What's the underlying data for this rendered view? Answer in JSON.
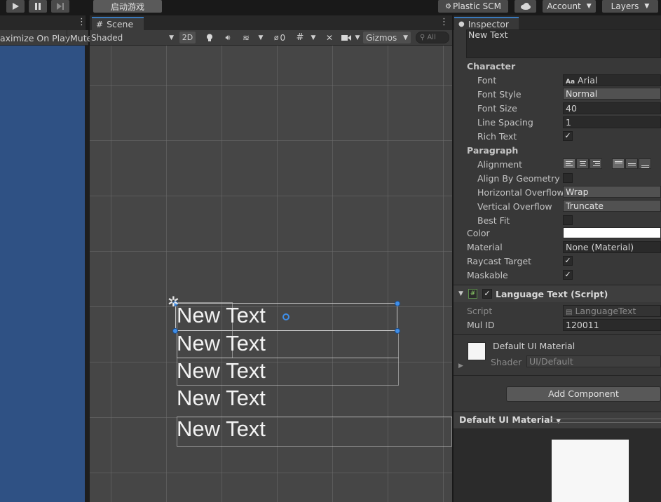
{
  "toolbar": {
    "play_icon": "play-icon",
    "pause_icon": "pause-icon",
    "step_icon": "step-icon",
    "start_game": "启动游戏",
    "plastic_scm": "Plastic SCM",
    "cloud_icon": "cloud-icon",
    "account": "Account",
    "layers": "Layers"
  },
  "game_view": {
    "maximize_on_play": "aximize On Play",
    "mute": "Mute",
    "background_color": "#2f5184"
  },
  "scene": {
    "tab_label": "Scene",
    "shading_mode": "Shaded",
    "mode_2d": "2D",
    "hidden_count": "0",
    "gizmos": "Gizmos",
    "search_placeholder": "All",
    "text_items": [
      "New Text",
      "New Text",
      "New Text",
      "New Text",
      "New Text"
    ]
  },
  "inspector": {
    "tab_label": "Inspector",
    "text_value": "New Text",
    "character_section": "Character",
    "font_label": "Font",
    "font_value": "Arial",
    "font_style_label": "Font Style",
    "font_style_value": "Normal",
    "font_size_label": "Font Size",
    "font_size_value": "40",
    "line_spacing_label": "Line Spacing",
    "line_spacing_value": "1",
    "rich_text_label": "Rich Text",
    "rich_text_checked": true,
    "paragraph_section": "Paragraph",
    "alignment_label": "Alignment",
    "align_by_geometry_label": "Align By Geometry",
    "align_by_geometry_checked": false,
    "horizontal_overflow_label": "Horizontal Overflow",
    "horizontal_overflow_value": "Wrap",
    "vertical_overflow_label": "Vertical Overflow",
    "vertical_overflow_value": "Truncate",
    "best_fit_label": "Best Fit",
    "best_fit_checked": false,
    "color_label": "Color",
    "color_value": "#ffffff",
    "material_label": "Material",
    "material_value": "None (Material)",
    "raycast_target_label": "Raycast Target",
    "raycast_target_checked": true,
    "maskable_label": "Maskable",
    "maskable_checked": true,
    "component_title": "Language Text (Script)",
    "script_label": "Script",
    "script_value": "LanguageText",
    "mul_id_label": "Mul ID",
    "mul_id_value": "120011",
    "material_name": "Default UI Material",
    "shader_label": "Shader",
    "shader_value": "UI/Default",
    "add_component": "Add Component",
    "preview_title": "Default UI Material"
  }
}
